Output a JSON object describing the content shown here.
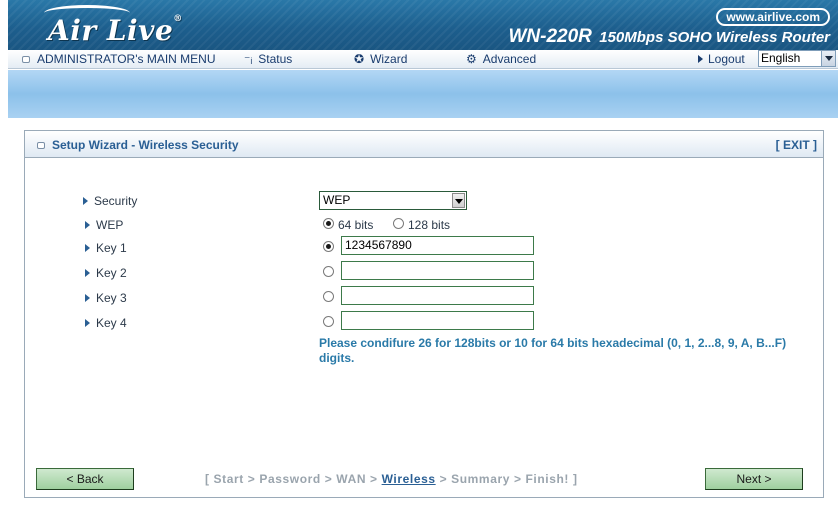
{
  "header": {
    "brand": "Air Live",
    "brand_mark": "®",
    "site": "www.airlive.com",
    "model": "WN-220R",
    "product_desc": "150Mbps SOHO Wireless Router"
  },
  "nav": {
    "main_menu": "ADMINISTRATOR's MAIN MENU",
    "status": "Status",
    "wizard": "Wizard",
    "advanced": "Advanced",
    "logout": "Logout",
    "language": "English"
  },
  "panel": {
    "title": "Setup Wizard - Wireless Security",
    "exit": "[ EXIT ]"
  },
  "form": {
    "security_label": "Security",
    "security_value": "WEP",
    "wep_label": "WEP",
    "wep_64": "64 bits",
    "wep_128": "128 bits",
    "wep_selected": "64 bits",
    "key1_label": "Key 1",
    "key1_value": "1234567890",
    "key2_label": "Key 2",
    "key2_value": "",
    "key3_label": "Key 3",
    "key3_value": "",
    "key4_label": "Key 4",
    "key4_value": "",
    "selected_key": "Key 1",
    "note_line1": "Please condifure 26 for 128bits or 10 for 64 bits hexadecimal (0, 1, 2...8, 9, A, B...F)",
    "note_line2": "digits."
  },
  "footer": {
    "back": "< Back",
    "next": "Next >",
    "steps_before": "[ Start > Password > WAN > ",
    "steps_current": "Wireless",
    "steps_after": " > Summary > Finish! ]"
  }
}
